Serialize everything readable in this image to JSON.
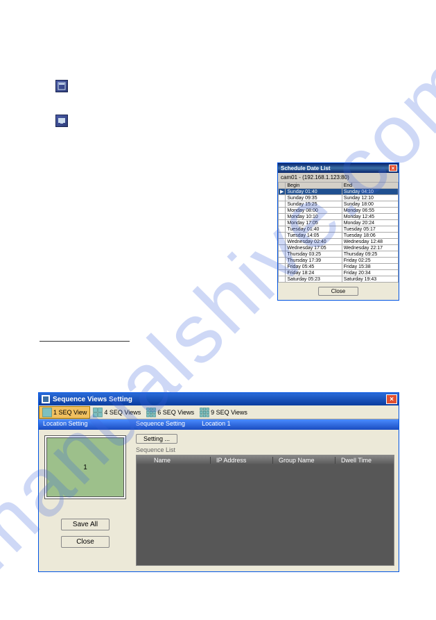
{
  "icons_top": {
    "icon1": "window-icon",
    "icon2": "screen-icon"
  },
  "schedule": {
    "title": "Schedule Date List",
    "caption": "cam01 - (192.168.1.123:80)",
    "headers": [
      "",
      "Begin",
      "End"
    ],
    "rows": [
      {
        "hl": true,
        "begin": "Sunday  01:40",
        "end": "Sunday  04:10"
      },
      {
        "hl": false,
        "begin": "Sunday  09:35",
        "end": "Sunday  12:10"
      },
      {
        "hl": false,
        "begin": "Sunday  15:25",
        "end": "Sunday  18:00"
      },
      {
        "hl": false,
        "begin": "Monday  08:00",
        "end": "Monday  06:55"
      },
      {
        "hl": false,
        "begin": "Monday  10:10",
        "end": "Monday  12:45"
      },
      {
        "hl": false,
        "begin": "Monday  17:05",
        "end": "Monday  20:24"
      },
      {
        "hl": false,
        "begin": "Tuesday  01:40",
        "end": "Tuesday  05:17"
      },
      {
        "hl": false,
        "begin": "Tuesday  14:05",
        "end": "Tuesday  18:06"
      },
      {
        "hl": false,
        "begin": "Wednesday  02:40",
        "end": "Wednesday  12:48"
      },
      {
        "hl": false,
        "begin": "Wednesday  17:05",
        "end": "Wednesday  22:17"
      },
      {
        "hl": false,
        "begin": "Thursday  03:25",
        "end": "Thursday  09:25"
      },
      {
        "hl": false,
        "begin": "Thursday  17:39",
        "end": "Friday  02:25"
      },
      {
        "hl": false,
        "begin": "Friday  05:45",
        "end": "Friday  15:38"
      },
      {
        "hl": false,
        "begin": "Friday  18:24",
        "end": "Friday  20:34"
      },
      {
        "hl": false,
        "begin": "Saturday  05:23",
        "end": "Saturday  19:43"
      }
    ],
    "close_label": "Close"
  },
  "seq": {
    "title": "Sequence Views Setting",
    "toolbar": [
      {
        "label": "1 SEQ View",
        "selected": true
      },
      {
        "label": "4 SEQ Views",
        "selected": false
      },
      {
        "label": "6 SEQ Views",
        "selected": false
      },
      {
        "label": "9 SEQ Views",
        "selected": false
      }
    ],
    "left": {
      "header": "Location Setting",
      "thumb_label": "1",
      "save_all": "Save All",
      "close": "Close"
    },
    "right": {
      "header": "Sequence Setting",
      "header2": "Location 1",
      "setting_label": "Setting ...",
      "list_label": "Sequence List",
      "columns": [
        "Name",
        "IP Address",
        "Group Name",
        "Dwell Time"
      ]
    }
  }
}
